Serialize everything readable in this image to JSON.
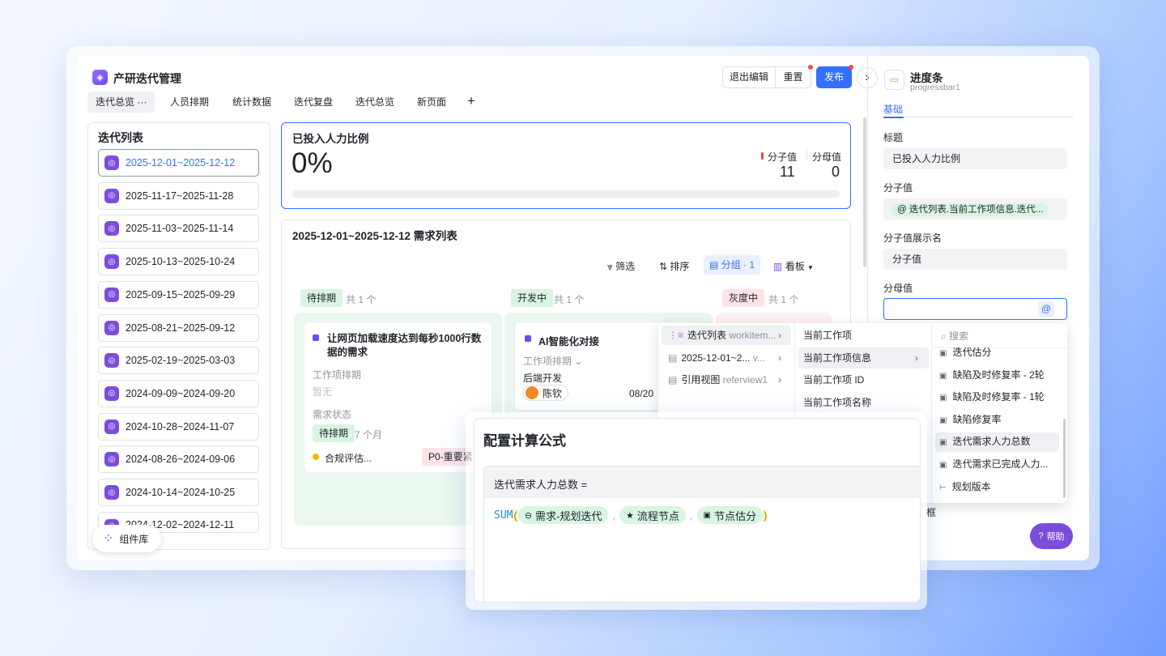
{
  "app": {
    "title": "产研迭代管理",
    "logo_icon": "layers-icon"
  },
  "tabs": [
    {
      "label": "迭代总览",
      "more": "···"
    },
    {
      "label": "人员排期"
    },
    {
      "label": "统计数据"
    },
    {
      "label": "迭代复盘"
    },
    {
      "label": "迭代总览"
    },
    {
      "label": "新页面"
    }
  ],
  "add_tab": "+",
  "toolbar": {
    "exit_edit": "退出编辑",
    "reset": "重置",
    "publish": "发布",
    "collapse": "›"
  },
  "iteration_list": {
    "title": "迭代列表",
    "items": [
      "2025-12-01~2025-12-12",
      "2025-11-17~2025-11-28",
      "2025-11-03~2025-11-14",
      "2025-10-13~2025-10-24",
      "2025-09-15~2025-09-29",
      "2025-08-21~2025-09-12",
      "2025-02-19~2025-03-03",
      "2024-09-09~2024-09-20",
      "2024-10-28~2024-11-07",
      "2024-08-26~2024-09-06",
      "2024-10-14~2024-10-25",
      "2024-12-02~2024-12-11"
    ]
  },
  "component_lib": "组件库",
  "progress_card": {
    "title": "已投入人力比例",
    "percent": "0%",
    "progress": 0,
    "numerator_label": "分子值",
    "denominator_label": "分母值",
    "numerator": "11",
    "denominator": "0"
  },
  "req_list": {
    "title": "2025-12-01~2025-12-12 需求列表",
    "filter": "筛选",
    "sort": "排序",
    "group": "分组 · 1",
    "view": "看板",
    "columns": [
      {
        "status": "待排期",
        "count": "共 1 个"
      },
      {
        "status": "开发中",
        "count": "共 1 个"
      },
      {
        "status": "灰度中",
        "count": "共 1 个"
      }
    ],
    "card1": {
      "title": "让网页加载速度达到每秒1000行数据的需求",
      "schedule_label": "工作项排期",
      "schedule_value": "暂无",
      "status_label": "需求状态",
      "status": "待排期",
      "duration": "7 个月",
      "tag": "合规评估...",
      "priority": "P0-重要紧"
    },
    "card2": {
      "title": "AI智能化对接",
      "schedule_label": "工作项排期",
      "role": "后端开发",
      "person": "陈钦",
      "date": "08/20"
    }
  },
  "props": {
    "name": "进度条",
    "id": "progressbar1",
    "tab": "基础",
    "title_label": "标题",
    "title_value": "已投入人力比例",
    "numerator_label": "分子值",
    "numerator_value": "迭代列表.当前工作项信息.迭代...",
    "num_display_label": "分子值展示名",
    "num_display_value": "分子值",
    "denominator_label": "分母值",
    "partial_label": "框",
    "help": "帮助"
  },
  "var_menu": {
    "col1": [
      {
        "label": "迭代列表",
        "sub": "workitem..."
      },
      {
        "label": "2025-12-01~2...",
        "sub": "v..."
      },
      {
        "label": "引用视图",
        "sub": "referview1"
      }
    ],
    "col2": [
      "当前工作项",
      "当前工作项信息",
      "当前工作项 ID",
      "当前工作项名称"
    ],
    "search": "搜索",
    "col3": [
      "迭代估分",
      "缺陷及时修复率 - 2轮",
      "缺陷及时修复率 - 1轮",
      "缺陷修复率",
      "迭代需求人力总数",
      "迭代需求已完成人力...",
      "规划版本"
    ]
  },
  "formula": {
    "title": "配置计算公式",
    "lhs": "迭代需求人力总数 =",
    "fn": "SUM",
    "args": [
      "需求-规划迭代",
      "流程节点",
      "节点估分"
    ],
    "sep": ","
  },
  "colors": {
    "primary": "#3370ff",
    "purple": "#7c4ddb",
    "green_chip": "#d8f4e2"
  }
}
